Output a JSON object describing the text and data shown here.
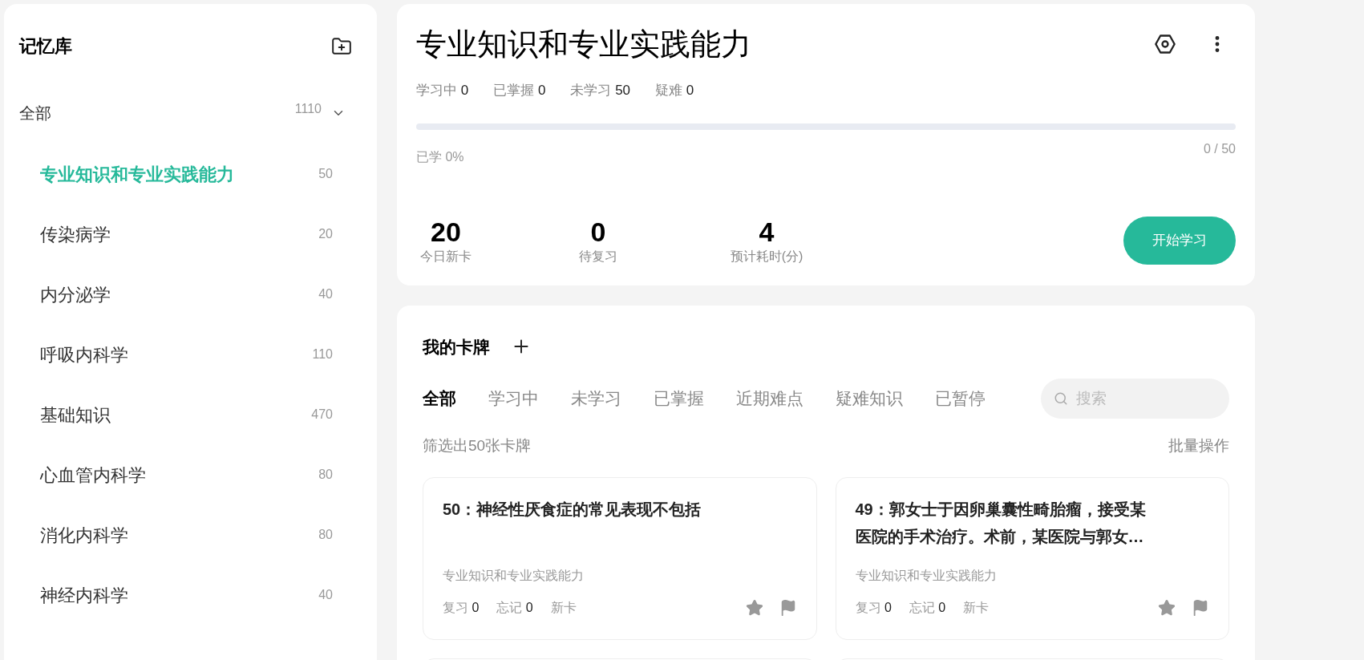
{
  "sidebar": {
    "title": "记忆库",
    "root": {
      "label": "全部",
      "count": "1110",
      "expanded": true,
      "children": [
        {
          "label": "专业知识和专业实践能力",
          "count": "50",
          "selected": true
        },
        {
          "label": "传染病学",
          "count": "20",
          "selected": false
        },
        {
          "label": "内分泌学",
          "count": "40",
          "selected": false
        },
        {
          "label": "呼吸内科学",
          "count": "110",
          "selected": false
        },
        {
          "label": "基础知识",
          "count": "470",
          "selected": false
        },
        {
          "label": "心血管内科学",
          "count": "80",
          "selected": false
        },
        {
          "label": "消化内科学",
          "count": "80",
          "selected": false
        },
        {
          "label": "神经内科学",
          "count": "40",
          "selected": false
        }
      ]
    }
  },
  "deck": {
    "title": "专业知识和专业实践能力",
    "stats": [
      {
        "label": "学习中",
        "value": "0"
      },
      {
        "label": "已掌握",
        "value": "0"
      },
      {
        "label": "未学习",
        "value": "50"
      },
      {
        "label": "疑难",
        "value": "0"
      }
    ],
    "progress": {
      "level": 0,
      "label": "已学 0%",
      "reading": "0 / 50"
    },
    "today": [
      {
        "value": "20",
        "label": "今日新卡"
      },
      {
        "value": "0",
        "label": "待复习"
      },
      {
        "value": "4",
        "label": "预计耗时(分)"
      }
    ],
    "start_button": "开始学习"
  },
  "cards_panel": {
    "title": "我的卡牌",
    "tabs": [
      {
        "label": "全部",
        "selected": true
      },
      {
        "label": "学习中",
        "selected": false
      },
      {
        "label": "未学习",
        "selected": false
      },
      {
        "label": "已掌握",
        "selected": false
      },
      {
        "label": "近期难点",
        "selected": false
      },
      {
        "label": "疑难知识",
        "selected": false
      },
      {
        "label": "已暂停",
        "selected": false
      }
    ],
    "search": {
      "placeholder": "搜索"
    },
    "filter_summary": "筛选出50张卡牌",
    "batch_action": "批量操作",
    "cards": [
      {
        "title": "50：神经性厌食症的常见表现不包括",
        "deck": "专业知识和专业实践能力",
        "stats": [
          {
            "label": "复习",
            "value": "0"
          },
          {
            "label": "忘记",
            "value": "0"
          }
        ],
        "tag": "新卡"
      },
      {
        "title": "49：郭女士于因卵巢囊性畸胎瘤，接受某医院的手术治疗。术前，某医院与郭女…",
        "deck": "专业知识和专业实践能力",
        "stats": [
          {
            "label": "复习",
            "value": "0"
          },
          {
            "label": "忘记",
            "value": "0"
          }
        ],
        "tag": "新卡"
      }
    ]
  }
}
